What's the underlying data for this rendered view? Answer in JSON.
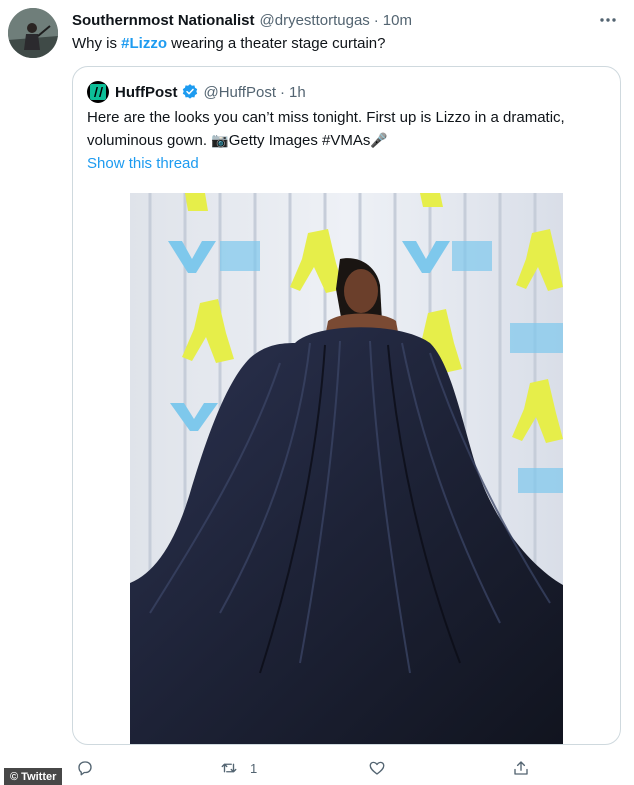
{
  "tweet": {
    "display_name": "Southernmost Nationalist",
    "handle": "@dryesttortugas",
    "separator": "·",
    "time": "10m",
    "text_before": "Why is ",
    "hashtag": "#Lizzo",
    "text_after": " wearing a theater stage curtain?"
  },
  "quoted": {
    "display_name": "HuffPost",
    "handle": "@HuffPost",
    "separator": "·",
    "time": "1h",
    "text": "Here are the looks you can’t miss tonight. First up is Lizzo in a dramatic, voluminous gown.",
    "camera_glyph": "📷",
    "credit": "Getty Images #VMAs",
    "mic_glyph": "🎤",
    "show_thread": "Show this thread",
    "logo_icon": "huffpost-logo-icon",
    "verified_icon": "verified-badge-icon"
  },
  "actions": {
    "retweet_count": "1"
  },
  "watermark": "© Twitter",
  "colors": {
    "link": "#1d9bf0",
    "secondary_text": "#536471",
    "border": "#cfd9de",
    "gown": "#1d2236"
  }
}
